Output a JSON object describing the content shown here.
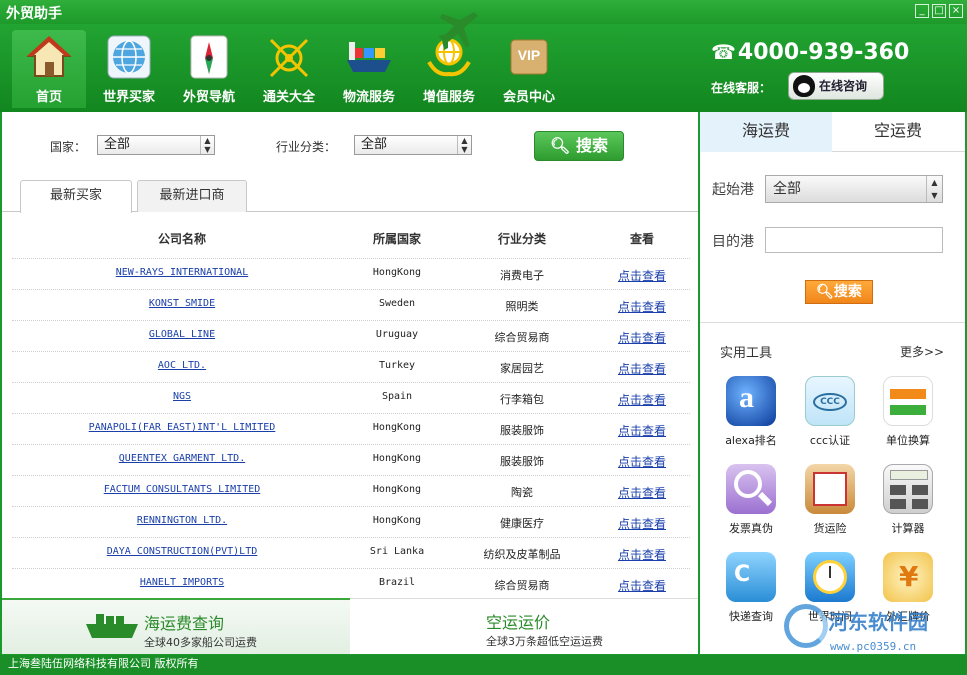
{
  "window": {
    "title": "外贸助手",
    "buttons": [
      "_",
      "□",
      "×"
    ]
  },
  "nav": {
    "items": [
      {
        "label": "首页",
        "icon": "home-icon",
        "active": true
      },
      {
        "label": "世界买家",
        "icon": "globe-icon"
      },
      {
        "label": "外贸导航",
        "icon": "compass-icon"
      },
      {
        "label": "通关大全",
        "icon": "customs-icon"
      },
      {
        "label": "物流服务",
        "icon": "ship-icon"
      },
      {
        "label": "增值服务",
        "icon": "hands-globe-icon"
      },
      {
        "label": "会员中心",
        "icon": "vip-icon"
      }
    ],
    "hotline": "4000-939-360",
    "online_label": "在线客服：",
    "online_button": "在线咨询"
  },
  "filters": {
    "country_label": "国家：",
    "country_value": "全部",
    "industry_label": "行业分类：",
    "industry_value": "全部",
    "search_label": "搜索"
  },
  "tabs": [
    "最新买家",
    "最新进口商"
  ],
  "table": {
    "headers": [
      "公司名称",
      "所属国家",
      "行业分类",
      "查看"
    ],
    "rows": [
      {
        "company": "NEW-RAYS INTERNATIONAL",
        "country": "HongKong",
        "category": "消费电子",
        "view": "点击查看"
      },
      {
        "company": "KONST SMIDE",
        "country": "Sweden",
        "category": "照明类",
        "view": "点击查看"
      },
      {
        "company": "GLOBAL LINE",
        "country": "Uruguay",
        "category": "综合贸易商",
        "view": "点击查看"
      },
      {
        "company": "AOC LTD.",
        "country": "Turkey",
        "category": "家居园艺",
        "view": "点击查看"
      },
      {
        "company": "NGS",
        "country": "Spain",
        "category": "行李箱包",
        "view": "点击查看"
      },
      {
        "company": "PANAPOLI(FAR EAST)INT'L LIMITED",
        "country": "HongKong",
        "category": "服装服饰",
        "view": "点击查看"
      },
      {
        "company": "QUEENTEX GARMENT LTD.",
        "country": "HongKong",
        "category": "服装服饰",
        "view": "点击查看"
      },
      {
        "company": "FACTUM CONSULTANTS LIMITED",
        "country": "HongKong",
        "category": "陶瓷",
        "view": "点击查看"
      },
      {
        "company": "RENNINGTON LTD.",
        "country": "HongKong",
        "category": "健康医疗",
        "view": "点击查看"
      },
      {
        "company": "DAYA CONSTRUCTION(PVT)LTD",
        "country": "Sri Lanka",
        "category": "纺织及皮革制品",
        "view": "点击查看"
      },
      {
        "company": "HANELT IMPORTS",
        "country": "Brazil",
        "category": "综合贸易商",
        "view": "点击查看"
      }
    ]
  },
  "promos": {
    "sea": {
      "title": "海运费查询",
      "subtitle": "全球40多家船公司运费"
    },
    "air": {
      "title": "空运运价",
      "subtitle": "全球3万条超低空运运费"
    }
  },
  "freight": {
    "tabs": [
      "海运费",
      "空运费"
    ],
    "origin_label": "起始港",
    "origin_value": "全部",
    "dest_label": "目的港",
    "dest_value": "",
    "search_label": "搜索"
  },
  "tools": {
    "title": "实用工具",
    "more": "更多>>",
    "items": [
      {
        "label": "alexa排名",
        "icon": "alexa-icon"
      },
      {
        "label": "ccc认证",
        "icon": "ccc-icon"
      },
      {
        "label": "单位换算",
        "icon": "convert-icon"
      },
      {
        "label": "发票真伪",
        "icon": "magnifier-icon"
      },
      {
        "label": "货运险",
        "icon": "insurance-icon"
      },
      {
        "label": "计算器",
        "icon": "calculator-icon"
      },
      {
        "label": "快递查询",
        "icon": "express-icon"
      },
      {
        "label": "世界时间",
        "icon": "clock-icon"
      },
      {
        "label": "外汇牌价",
        "icon": "currency-icon"
      }
    ]
  },
  "status": "上海叁陆伍网络科技有限公司 版权所有",
  "watermark": {
    "text": "河东软件园",
    "url": "www.pc0359.cn"
  },
  "colors": {
    "brand_green": "#1a9a2c",
    "link_blue": "#1a3faa",
    "accent_orange": "#f0861a"
  }
}
